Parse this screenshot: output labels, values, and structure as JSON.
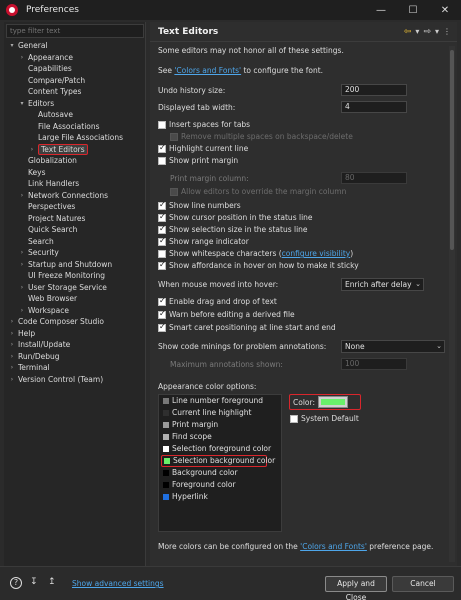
{
  "window": {
    "title": "Preferences",
    "minimize": "—",
    "maximize": "☐",
    "close": "✕"
  },
  "filter": {
    "placeholder": "type filter text"
  },
  "tree": [
    {
      "label": "General",
      "level": 0,
      "expanded": true
    },
    {
      "label": "Appearance",
      "level": 1,
      "collapsed": true
    },
    {
      "label": "Capabilities",
      "level": 1
    },
    {
      "label": "Compare/Patch",
      "level": 1
    },
    {
      "label": "Content Types",
      "level": 1
    },
    {
      "label": "Editors",
      "level": 1,
      "expanded": true
    },
    {
      "label": "Autosave",
      "level": 2
    },
    {
      "label": "File Associations",
      "level": 2
    },
    {
      "label": "Large File Associations",
      "level": 2
    },
    {
      "label": "Text Editors",
      "level": 2,
      "collapsed": true,
      "selected": true
    },
    {
      "label": "Globalization",
      "level": 1
    },
    {
      "label": "Keys",
      "level": 1
    },
    {
      "label": "Link Handlers",
      "level": 1
    },
    {
      "label": "Network Connections",
      "level": 1,
      "collapsed": true
    },
    {
      "label": "Perspectives",
      "level": 1
    },
    {
      "label": "Project Natures",
      "level": 1
    },
    {
      "label": "Quick Search",
      "level": 1
    },
    {
      "label": "Search",
      "level": 1
    },
    {
      "label": "Security",
      "level": 1,
      "collapsed": true
    },
    {
      "label": "Startup and Shutdown",
      "level": 1,
      "collapsed": true
    },
    {
      "label": "UI Freeze Monitoring",
      "level": 1
    },
    {
      "label": "User Storage Service",
      "level": 1,
      "collapsed": true
    },
    {
      "label": "Web Browser",
      "level": 1
    },
    {
      "label": "Workspace",
      "level": 1,
      "collapsed": true
    },
    {
      "label": "Code Composer Studio",
      "level": 0,
      "collapsed": true
    },
    {
      "label": "Help",
      "level": 0,
      "collapsed": true
    },
    {
      "label": "Install/Update",
      "level": 0,
      "collapsed": true
    },
    {
      "label": "Run/Debug",
      "level": 0,
      "collapsed": true
    },
    {
      "label": "Terminal",
      "level": 0,
      "collapsed": true
    },
    {
      "label": "Version Control (Team)",
      "level": 0,
      "collapsed": true
    }
  ],
  "panel": {
    "title": "Text Editors",
    "note": "Some editors may not honor all of these settings.",
    "see_prefix": "See ",
    "see_link": "'Colors and Fonts'",
    "see_suffix": " to configure the font.",
    "undo_label": "Undo history size:",
    "undo_value": "200",
    "tab_label": "Displayed tab width:",
    "tab_value": "4",
    "insert_spaces": "Insert spaces for tabs",
    "remove_spaces": "Remove multiple spaces on backspace/delete",
    "highlight_line": "Highlight current line",
    "print_margin": "Show print margin",
    "print_margin_col": "Print margin column:",
    "print_margin_value": "80",
    "allow_override": "Allow editors to override the margin column",
    "line_numbers": "Show line numbers",
    "cursor_pos": "Show cursor position in the status line",
    "selection_size": "Show selection size in the status line",
    "range_indicator": "Show range indicator",
    "whitespace_prefix": "Show whitespace characters (",
    "whitespace_link": "configure visibility",
    "whitespace_suffix": ")",
    "affordance": "Show affordance in hover on how to make it sticky",
    "hover_label": "When mouse moved into hover:",
    "hover_value": "Enrich after delay",
    "drag_drop": "Enable drag and drop of text",
    "warn_derived": "Warn before editing a derived file",
    "smart_caret": "Smart caret positioning at line start and end",
    "minings_label": "Show code minings for problem annotations:",
    "minings_value": "None",
    "max_annotations": "Maximum annotations shown:",
    "max_annotations_value": "100",
    "appearance_label": "Appearance color options:",
    "color_label": "Color:",
    "system_default": "System Default",
    "more_colors_prefix": "More colors can be configured on the ",
    "more_colors_link": "'Colors and Fonts'",
    "more_colors_suffix": " preference page."
  },
  "color_options": [
    {
      "name": "Line number foreground",
      "swatch": "#787878"
    },
    {
      "name": "Current line highlight",
      "swatch": "#2f2f2f"
    },
    {
      "name": "Print margin",
      "swatch": "#9a9a9a"
    },
    {
      "name": "Find scope",
      "swatch": "#b0b0b0"
    },
    {
      "name": "Selection foreground color",
      "swatch": "#ffffff"
    },
    {
      "name": "Selection background color",
      "swatch": "#69f06a",
      "selected": true
    },
    {
      "name": "Background color",
      "swatch": "#000000"
    },
    {
      "name": "Foreground color",
      "swatch": "#000000"
    },
    {
      "name": "Hyperlink",
      "swatch": "#1f6fe0"
    }
  ],
  "selected_color": "#69f06a",
  "bottom": {
    "help": "?",
    "advanced_link": "Show advanced settings",
    "apply_close": "Apply and Close",
    "cancel": "Cancel"
  }
}
